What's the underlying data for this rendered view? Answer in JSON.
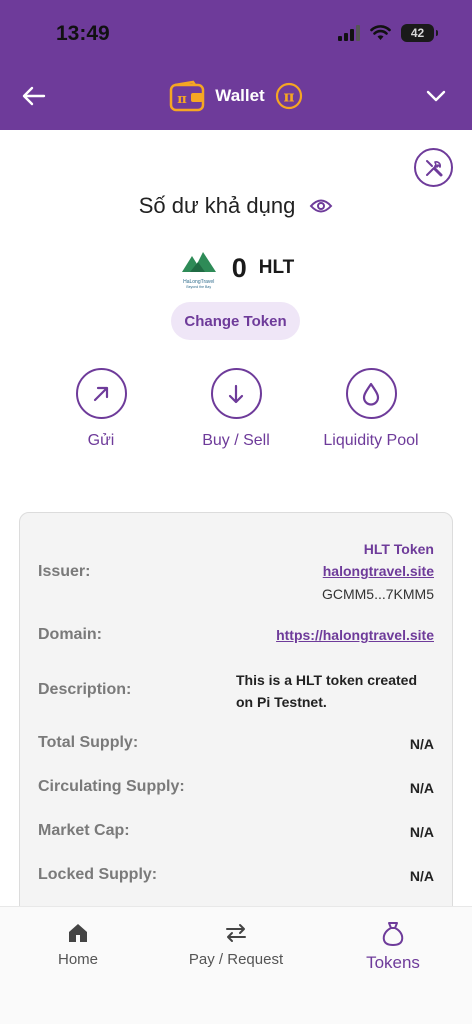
{
  "status_bar": {
    "time": "13:49",
    "battery": "42"
  },
  "header": {
    "title": "Wallet"
  },
  "balance": {
    "label": "Số dư khả dụng",
    "amount": "0",
    "symbol": "HLT",
    "logo_text": "HaLongTravel",
    "logo_subtext": "Beyond the Bay"
  },
  "change_token": {
    "label": "Change Token"
  },
  "actions": [
    {
      "label": "Gửi"
    },
    {
      "label": "Buy / Sell"
    },
    {
      "label": "Liquidity Pool"
    }
  ],
  "info": {
    "issuer": {
      "key": "Issuer:",
      "name": "HLT Token",
      "link": "halongtravel.site",
      "address": "GCMM5...7KMM5"
    },
    "domain": {
      "key": "Domain:",
      "value": "https://halongtravel.site"
    },
    "description": {
      "key": "Description:",
      "value": "This is a HLT token created on Pi Testnet."
    },
    "total_supply": {
      "key": "Total Supply:",
      "value": "N/A"
    },
    "circulating_supply": {
      "key": "Circulating Supply:",
      "value": "N/A"
    },
    "market_cap": {
      "key": "Market Cap:",
      "value": "N/A"
    },
    "locked_supply": {
      "key": "Locked Supply:",
      "value": "N/A"
    }
  },
  "nav": [
    {
      "label": "Home",
      "icon": "home-icon"
    },
    {
      "label": "Pay / Request",
      "icon": "swap-icon"
    },
    {
      "label": "Tokens",
      "icon": "bag-icon"
    }
  ],
  "colors": {
    "brand": "#6e3b9a",
    "accent": "#f5a623",
    "chip_bg": "#efe6f7"
  }
}
